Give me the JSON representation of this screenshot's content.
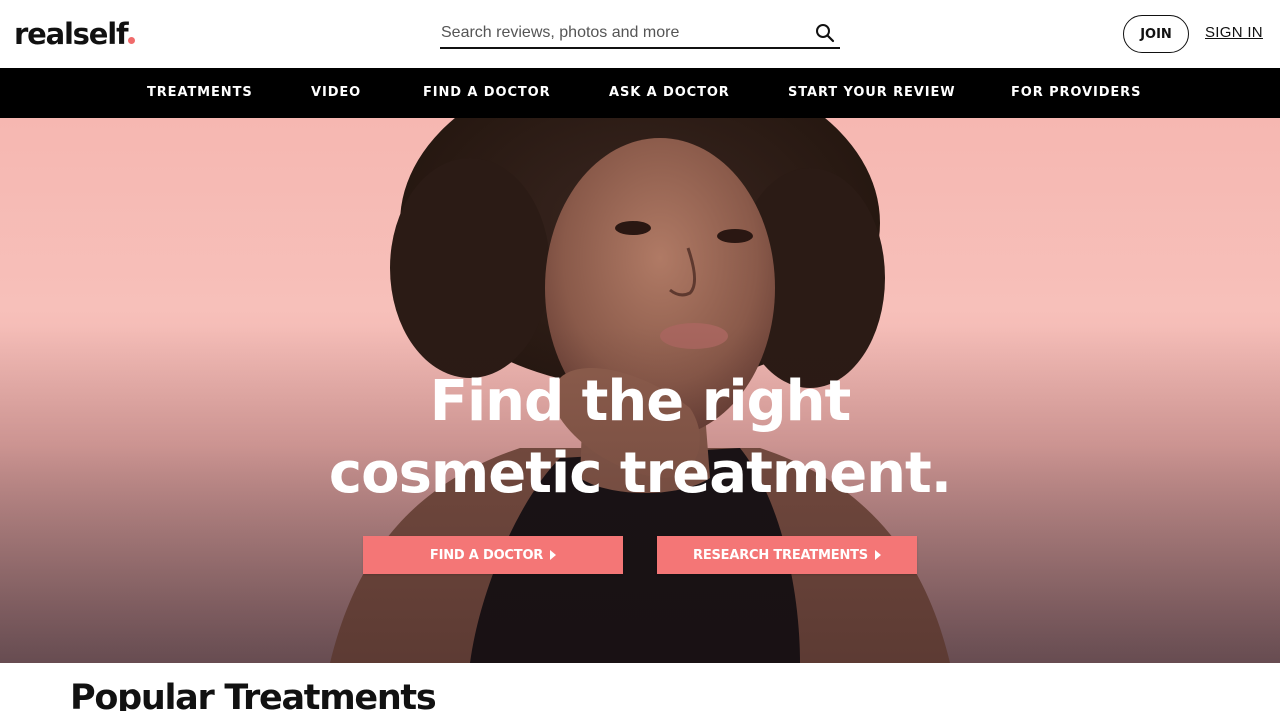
{
  "header": {
    "logo": "realself",
    "search_placeholder": "Search reviews, photos and more",
    "search_icon": "search-icon",
    "join_label": "JOIN",
    "signin_label": "SIGN IN"
  },
  "nav": {
    "items": [
      {
        "label": "TREATMENTS"
      },
      {
        "label": "VIDEO"
      },
      {
        "label": "FIND A DOCTOR"
      },
      {
        "label": "ASK A DOCTOR"
      },
      {
        "label": "START YOUR REVIEW"
      },
      {
        "label": "FOR PROVIDERS"
      }
    ]
  },
  "hero": {
    "title_line1": "Find the right",
    "title_line2": "cosmetic treatment.",
    "cta_primary": "FIND A DOCTOR",
    "cta_secondary": "RESEARCH TREATMENTS"
  },
  "popular": {
    "title": "Popular Treatments"
  },
  "colors": {
    "accent": "#f47676",
    "logo_dot": "#f06b6b",
    "nav_bg": "#000000",
    "hero_bg": "#f7c0ba"
  }
}
